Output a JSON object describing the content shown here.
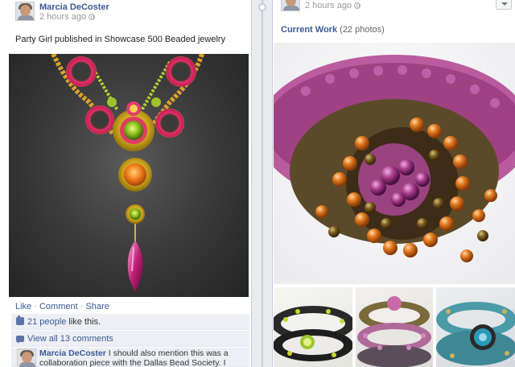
{
  "left_post": {
    "author": "Marcia DeCoster",
    "timestamp": "2 hours ago",
    "text": "Party Girl published in Showcase 500 Beaded jewelry",
    "actions": {
      "like": "Like",
      "separator": "·",
      "comment": "Comment",
      "share": "Share"
    },
    "likes": {
      "people": "21 people",
      "suffix": " like this."
    },
    "view_comments": "View all 13 comments",
    "comment": {
      "author": "Marcia DeCoster",
      "text": "I should also mention this was a collaboration piece with the Dallas Bead Society. I taught"
    }
  },
  "right_post": {
    "timestamp": "2 hours ago",
    "album": {
      "name": "Current Work",
      "count": "(22 photos)"
    }
  },
  "icons": {
    "privacy": "globe-icon",
    "like": "like-icon",
    "comments": "comment-icon",
    "menu": "chevron-down-icon"
  },
  "colors": {
    "link": "#3b5998",
    "ufi_background": "#edeff4",
    "timeline_background": "#e9ebee"
  }
}
